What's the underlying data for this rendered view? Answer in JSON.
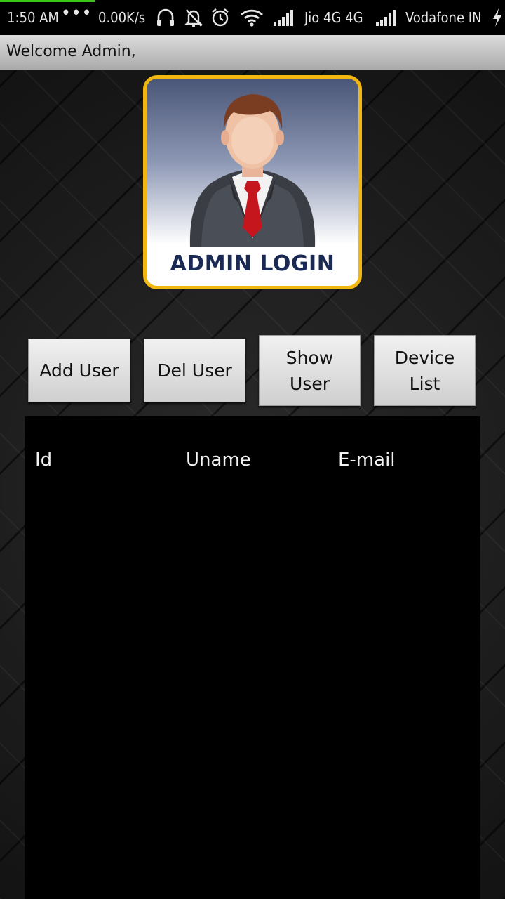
{
  "status_bar": {
    "time": "1:50 AM",
    "dots": "•••",
    "net_speed": "0.00K/s",
    "carrier1": "Jio 4G 4G",
    "carrier2": "Vodafone IN",
    "icons": [
      "headset-icon",
      "notifications-off-icon",
      "alarm-icon",
      "wifi-icon",
      "signal-icon",
      "signal-icon",
      "charging-icon"
    ],
    "progress_color": "#3fc21a"
  },
  "action_bar": {
    "title": "Welcome Admin,"
  },
  "logo": {
    "caption": "ADMIN LOGIN",
    "border_color": "#f2b611"
  },
  "buttons": {
    "add_user": "Add User",
    "del_user": "Del User",
    "show_user": [
      "Show",
      "User"
    ],
    "device_list": [
      "Device",
      "List"
    ]
  },
  "table": {
    "columns": [
      "Id",
      "Uname",
      "E-mail"
    ],
    "rows": []
  }
}
